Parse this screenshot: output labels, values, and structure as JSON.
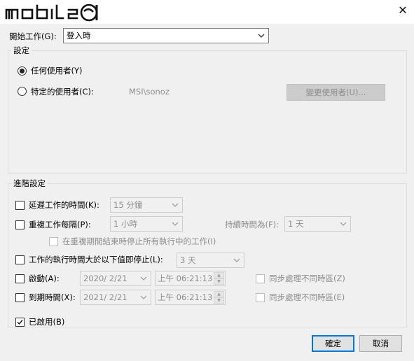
{
  "titlebar": {
    "logo_text": "mobile01",
    "close_icon": "close-icon"
  },
  "start_task": {
    "label": "開始工作(G):",
    "value": "登入時"
  },
  "settings": {
    "legend": "設定",
    "any_user_label": "任何使用者(Y)",
    "specific_user_label": "特定的使用者(C):",
    "user_value": "MSI\\sonoz",
    "change_user_button": "變更使用者(U)...",
    "selected": "any_user"
  },
  "advanced": {
    "legend": "進階設定",
    "delay": {
      "label": "延遲工作的時間(K):",
      "value": "15 分鐘",
      "checked": false
    },
    "repeat": {
      "label": "重複工作每隔(P):",
      "value": "1 小時",
      "checked": false,
      "duration_label": "持續時間為(F):",
      "duration_value": "1 天"
    },
    "stop_all": {
      "label": "在重複期間結束時停止所有執行中的工作(I)",
      "checked": false
    },
    "stop_if": {
      "label": "工作的執行時間大於以下值即停止(L):",
      "value": "3 天",
      "checked": false
    },
    "activate": {
      "label": "啟動(A):",
      "date": "2020/  2/21",
      "time": "上午 06:21:13",
      "sync_label": "同步處理不同時區(Z)",
      "checked": false
    },
    "expire": {
      "label": "到期時間(X):",
      "date": "2021/  2/21",
      "time": "上午 06:21:13",
      "sync_label": "同步處理不同時區(E)",
      "checked": false
    },
    "enabled": {
      "label": "已啟用(B)",
      "checked": true
    }
  },
  "buttons": {
    "ok": "確定",
    "cancel": "取消"
  }
}
